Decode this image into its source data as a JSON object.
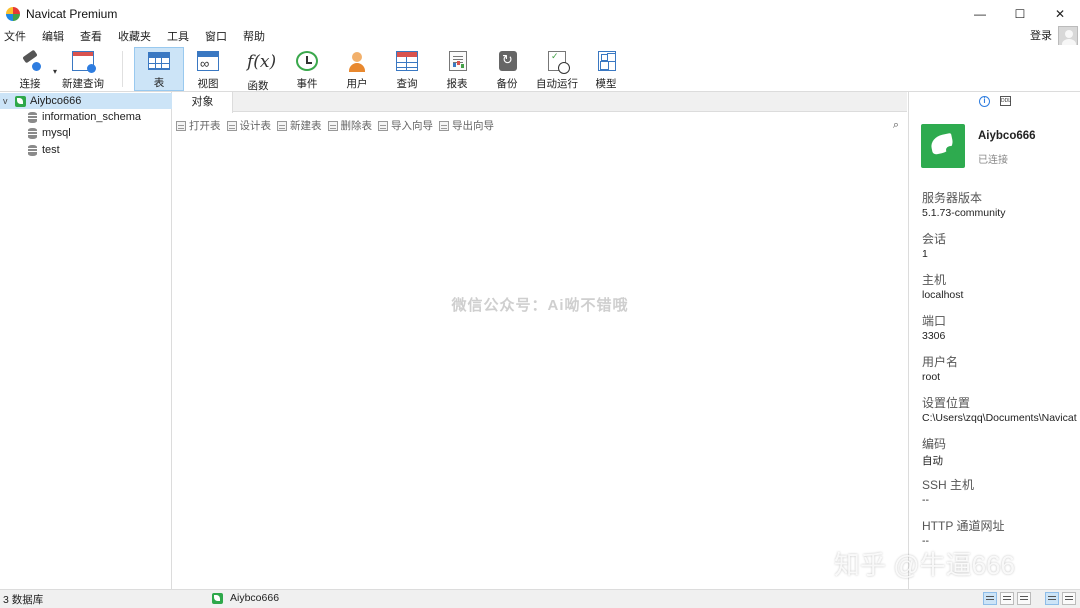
{
  "window": {
    "title": "Navicat Premium",
    "controls": [
      "—",
      "☐",
      "✕"
    ]
  },
  "menu": {
    "items": [
      "文件",
      "编辑",
      "查看",
      "收藏夹",
      "工具",
      "窗口",
      "帮助"
    ],
    "login": "登录"
  },
  "toolbar": {
    "connect": "连接",
    "new_query": "新建查询",
    "table": "表",
    "view": "视图",
    "function": "函数",
    "event": "事件",
    "user": "用户",
    "query": "查询",
    "report": "报表",
    "backup": "备份",
    "automation": "自动运行",
    "model": "模型"
  },
  "tree": {
    "connection": "Aiybco666",
    "databases": [
      "information_schema",
      "mysql",
      "test"
    ]
  },
  "tabs": {
    "objects": "对象"
  },
  "object_toolbar": {
    "open_table": "打开表",
    "design_table": "设计表",
    "new_table": "新建表",
    "delete_table": "删除表",
    "import_wizard": "导入向导",
    "export_wizard": "导出向导"
  },
  "watermark": "微信公众号：Ai呦不错哦",
  "info_panel": {
    "name": "Aiybco666",
    "status": "已连接",
    "fields": [
      {
        "label": "服务器版本",
        "value": "5.1.73-community"
      },
      {
        "label": "会话",
        "value": "1"
      },
      {
        "label": "主机",
        "value": "localhost"
      },
      {
        "label": "端口",
        "value": "3306"
      },
      {
        "label": "用户名",
        "value": "root"
      },
      {
        "label": "设置位置",
        "value": "C:\\Users\\zqq\\Documents\\Navicat"
      },
      {
        "label": "编码",
        "value": "自动"
      },
      {
        "label": "SSH 主机",
        "value": "--"
      },
      {
        "label": "HTTP 通道网址",
        "value": "--"
      }
    ]
  },
  "statusbar": {
    "db_count": "3 数据库",
    "connection": "Aiybco666"
  },
  "zhihu_watermark": "知乎 @牛逼666",
  "colors": {
    "accent": "#cce4f7",
    "connection_green": "#2eab4f",
    "info_blue": "#2e7de0"
  }
}
